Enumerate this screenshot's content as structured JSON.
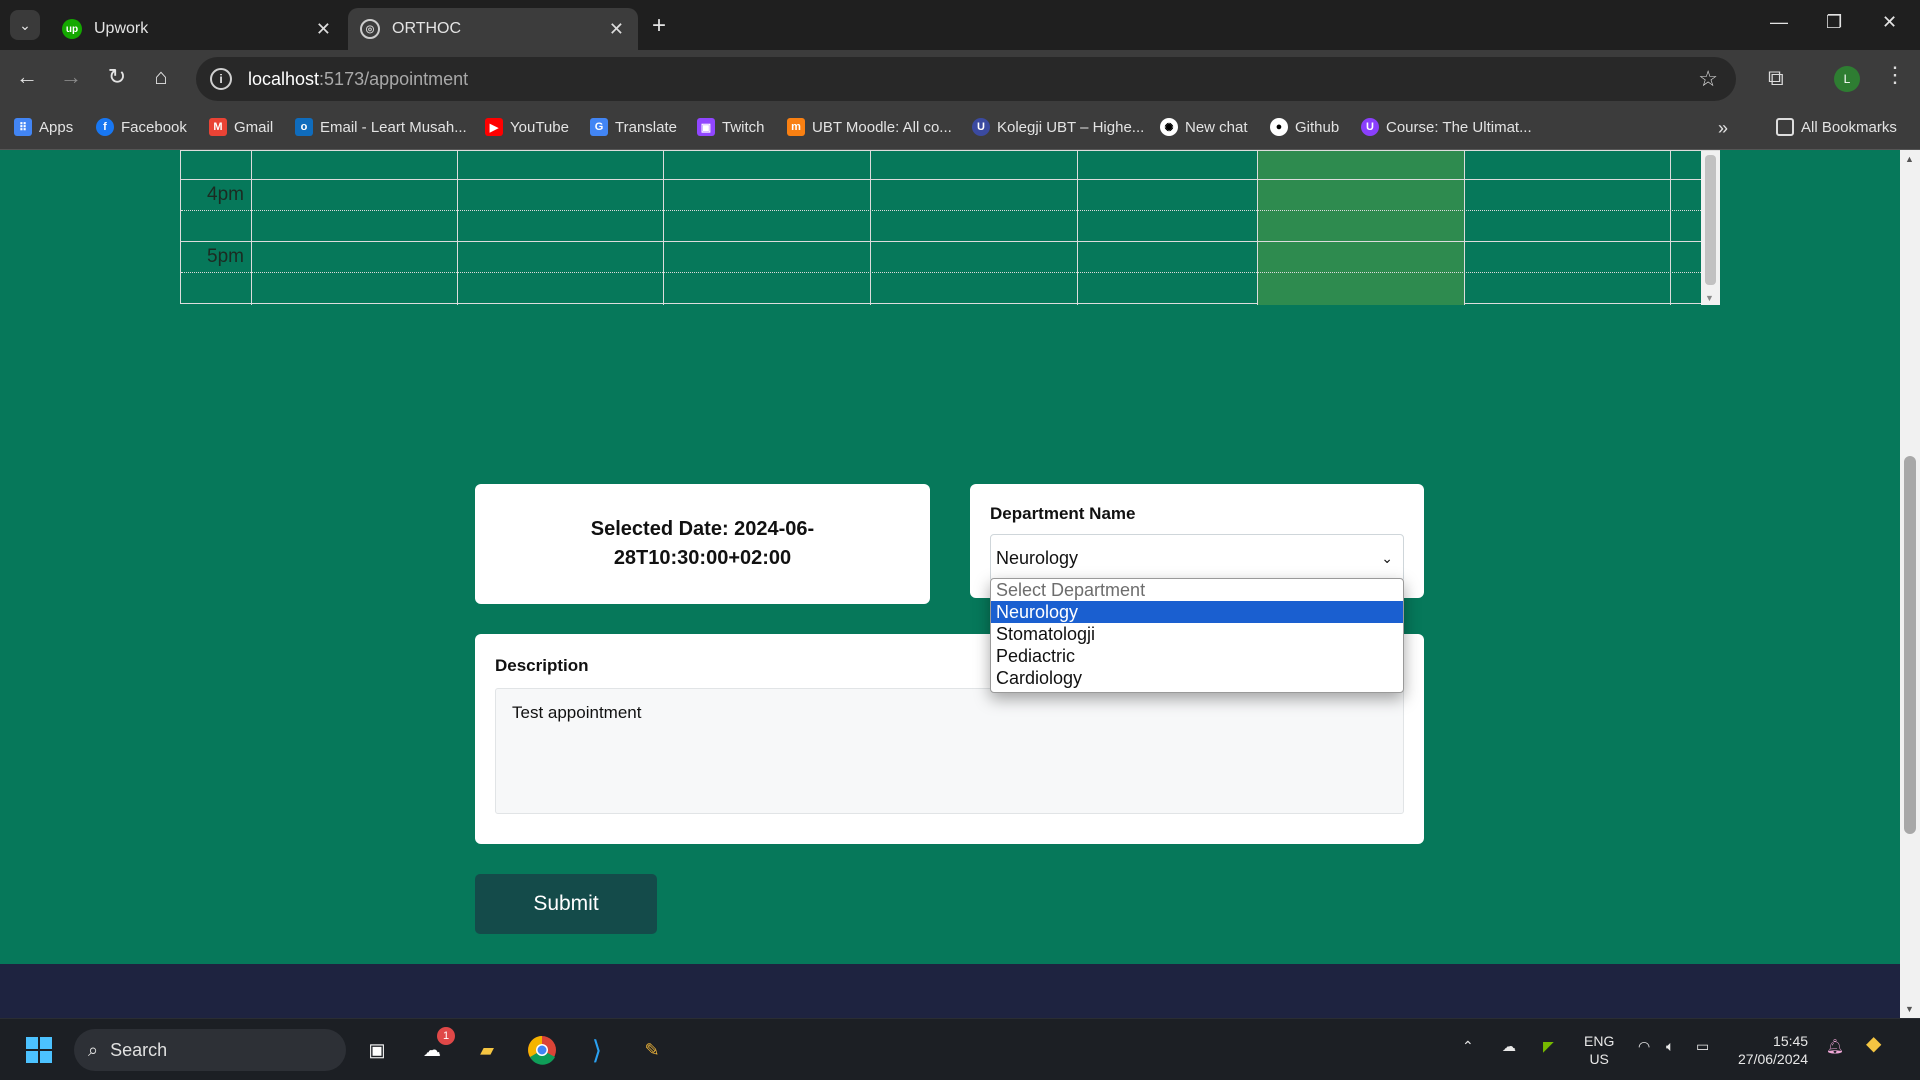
{
  "browser": {
    "tabs": [
      {
        "title": "Upwork",
        "active": false
      },
      {
        "title": "ORTHOC",
        "active": true
      }
    ],
    "url_host": "localhost",
    "url_rest": ":5173/appointment",
    "profile_initial": "L",
    "bookmarks": [
      {
        "label": "Apps",
        "icon": "apps-grid-icon",
        "color": "#4285f4"
      },
      {
        "label": "Facebook",
        "icon": "facebook-icon",
        "color": "#1877f2"
      },
      {
        "label": "Gmail",
        "icon": "gmail-icon",
        "color": "#ea4335"
      },
      {
        "label": "Email - Leart Musah...",
        "icon": "outlook-icon",
        "color": "#0f6cbd"
      },
      {
        "label": "YouTube",
        "icon": "youtube-icon",
        "color": "#ff0000"
      },
      {
        "label": "Translate",
        "icon": "translate-icon",
        "color": "#4285f4"
      },
      {
        "label": "Twitch",
        "icon": "twitch-icon",
        "color": "#9146ff"
      },
      {
        "label": "UBT Moodle: All co...",
        "icon": "moodle-icon",
        "color": "#f98012"
      },
      {
        "label": "Kolegji UBT – Highe...",
        "icon": "ubt-icon",
        "color": "#3b4aa0"
      },
      {
        "label": "New chat",
        "icon": "chatgpt-icon",
        "color": "#ffffff"
      },
      {
        "label": "Github",
        "icon": "github-icon",
        "color": "#ffffff"
      },
      {
        "label": "Course: The Ultimat...",
        "icon": "course-icon",
        "color": "#8a3ffc"
      }
    ],
    "all_bookmarks": "All Bookmarks"
  },
  "calendar": {
    "time_labels": [
      "4pm",
      "5pm"
    ],
    "highlight_color": "#2e8b4f"
  },
  "selected_date": {
    "text": "Selected Date: 2024-06-28T10:30:00+02:00"
  },
  "department": {
    "label": "Department Name",
    "value": "Neurology",
    "options": [
      "Select Department",
      "Neurology",
      "Stomatologji",
      "Pediactric",
      "Cardiology"
    ],
    "selected_index": 1
  },
  "description": {
    "label": "Description",
    "value": "Test appointment"
  },
  "submit_label": "Submit",
  "colors": {
    "page_bg": "#06785a",
    "submit_bg": "#144b4a",
    "footer_bg": "#1e2340",
    "option_highlight": "#1a5fd0"
  },
  "taskbar": {
    "search_label": "Search",
    "notification_count": "1",
    "lang_line1": "ENG",
    "lang_line2": "US",
    "time": "15:45",
    "date": "27/06/2024"
  }
}
